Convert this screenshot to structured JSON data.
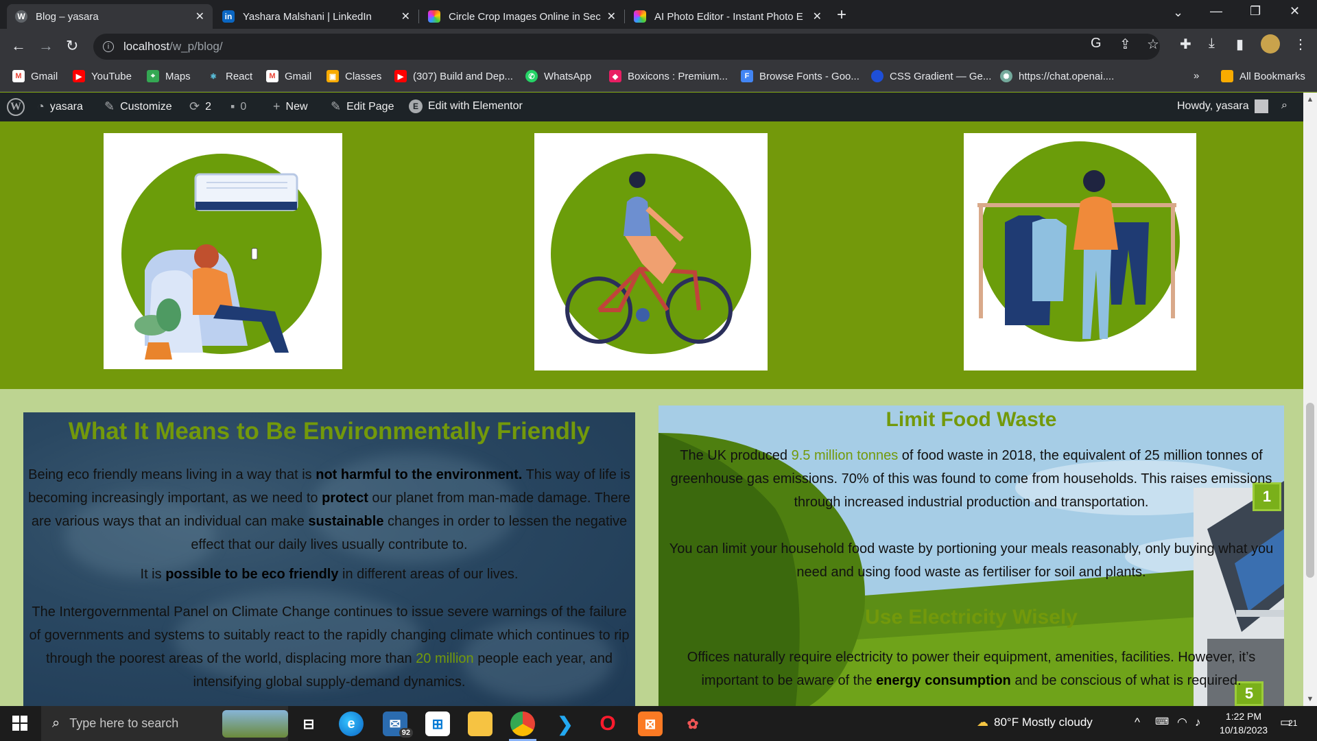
{
  "browser": {
    "tabs": [
      {
        "title": "Blog – yasara",
        "favicon": "wordpress-icon",
        "active": true
      },
      {
        "title": "Yashara Malshani | LinkedIn",
        "favicon": "linkedin-icon",
        "active": false
      },
      {
        "title": "Circle Crop Images Online in Sec",
        "favicon": "circle-crop-icon",
        "active": false
      },
      {
        "title": "AI Photo Editor - Instant Photo E",
        "favicon": "photo-editor-icon",
        "active": false
      }
    ],
    "url_host": "localhost",
    "url_path": "/w_p/blog/",
    "bookmarks": [
      {
        "label": "Gmail",
        "icon": "gmail-icon"
      },
      {
        "label": "YouTube",
        "icon": "youtube-icon"
      },
      {
        "label": "Maps",
        "icon": "maps-icon"
      },
      {
        "label": "React",
        "icon": "react-icon"
      },
      {
        "label": "Gmail",
        "icon": "gmail-icon"
      },
      {
        "label": "Classes",
        "icon": "classroom-icon"
      },
      {
        "label": "(307) Build and Dep...",
        "icon": "youtube-icon"
      },
      {
        "label": "WhatsApp",
        "icon": "whatsapp-icon"
      },
      {
        "label": "Boxicons : Premium...",
        "icon": "boxicons-icon"
      },
      {
        "label": "Browse Fonts - Goo...",
        "icon": "google-fonts-icon"
      },
      {
        "label": "CSS Gradient — Ge...",
        "icon": "css-gradient-icon"
      },
      {
        "label": "https://chat.openai....",
        "icon": "openai-icon"
      }
    ],
    "more_bookmarks": "»",
    "all_bookmarks": "All Bookmarks"
  },
  "wp_admin": {
    "site_name": "yasara",
    "customize": "Customize",
    "updates_count": "2",
    "comments_count": "0",
    "new": "New",
    "edit_page": "Edit Page",
    "edit_elementor": "Edit with Elementor",
    "howdy": "Howdy, yasara"
  },
  "content": {
    "left": {
      "title": "What It Means to Be Environmentally Friendly",
      "p1_a": "Being eco friendly means living in a way that is ",
      "p1_b": "not harmful to the environment.",
      "p1_c": " This way of life is becoming increasingly important, as we need to ",
      "p1_d": "protect",
      "p1_e": " our planet from man-made damage. There are various ways that an individual can make ",
      "p1_f": "sustainable",
      "p1_g": " changes in order to lessen the negative effect that our daily lives usually contribute to.",
      "p2_a": "It is ",
      "p2_b": "possible to be eco friendly",
      "p2_c": " in different areas of our lives.",
      "p3_a": "The Intergovernmental Panel on Climate Change continues to issue severe warnings of the failure of governments and systems to suitably react to the rapidly changing climate which continues to rip through the poorest areas of the world, displacing more than ",
      "p3_b": "20 million",
      "p3_c": " people each year, and intensifying global supply-demand dynamics."
    },
    "right": {
      "title1": "Limit Food Waste",
      "p1_a": "The UK produced ",
      "p1_b": "9.5 million tonnes",
      "p1_c": " of food waste in 2018, the equivalent of 25 million tonnes of greenhouse gas emissions. 70% of this was found to come from households. This raises emissions through increased industrial production and transportation.",
      "p2": "You can limit your household food waste by portioning your meals reasonably, only buying what you need and using food waste as fertiliser for soil and plants.",
      "title2": "Use Electricity Wisely",
      "p3_a": "Offices naturally require electricity to power their equipment, amenities, facilities. However, it’s important to be aware of the ",
      "p3_b": "energy consumption",
      "p3_c": " and be conscious of what is required.",
      "badge1": "1",
      "badge5": "5"
    }
  },
  "taskbar": {
    "search_placeholder": "Type here to search",
    "mail_badge": "92",
    "weather": "80°F  Mostly cloudy",
    "time": "1:22 PM",
    "date": "10/18/2023",
    "notifications": "21"
  },
  "colors": {
    "brand_green": "#73990b",
    "light_green": "#bdd491",
    "wp_bar": "#1d2327"
  }
}
